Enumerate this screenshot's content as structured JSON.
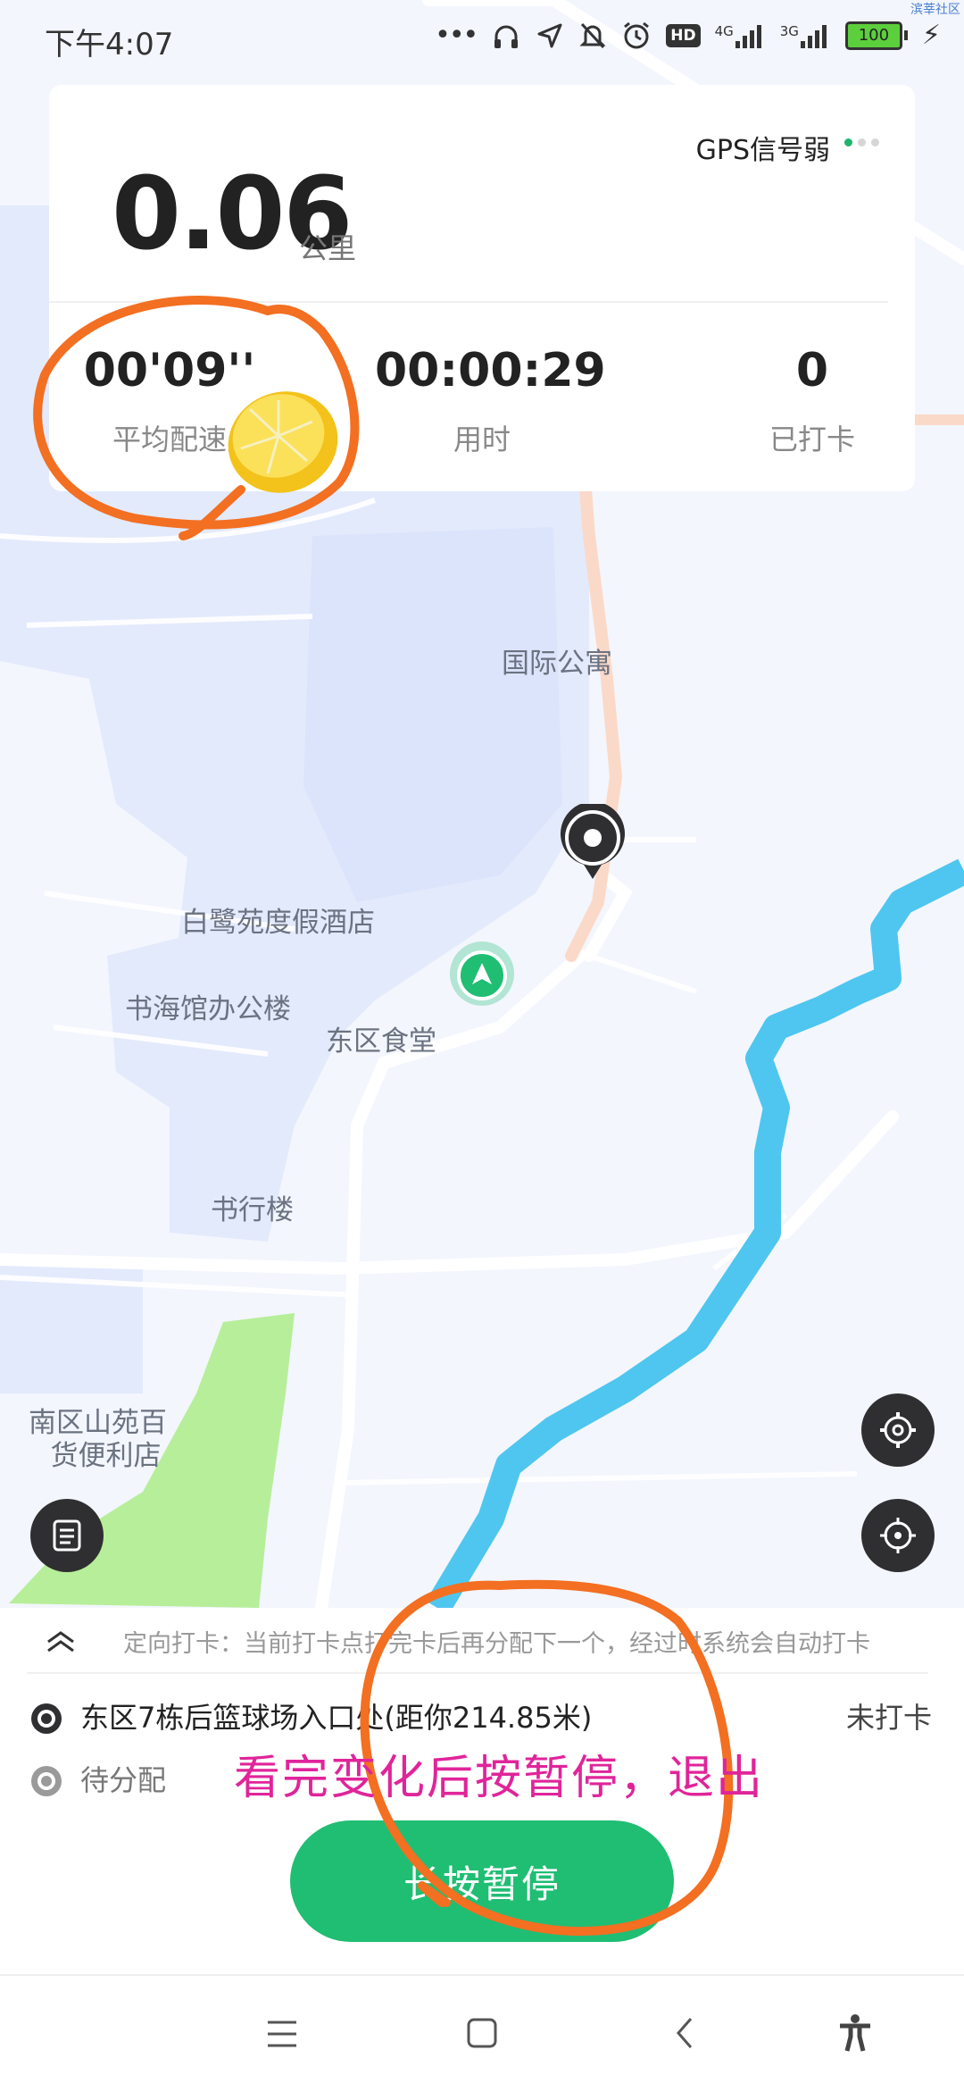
{
  "status_bar": {
    "time": "下午4:07",
    "net1": "4G",
    "net2": "3G",
    "battery": "100",
    "hd": "HD",
    "corner_text": "滨莘社区"
  },
  "stats": {
    "gps_status": "GPS信号弱",
    "distance": "0.06",
    "distance_unit": "公里",
    "pace_value": "00'09''",
    "pace_label": "平均配速",
    "duration_value": "00:00:29",
    "duration_label": "用时",
    "checked_value": "0",
    "checked_label": "已打卡"
  },
  "map": {
    "labels": {
      "international_apartment": "国际公寓",
      "egret_hotel": "白鹭苑度假酒店",
      "bookhall_office": "书海馆办公楼",
      "east_canteen": "东区食堂",
      "shuxing_building": "书行楼",
      "store_line1": "南区山苑百",
      "store_line2": "货便利店"
    }
  },
  "panel": {
    "hint": "定向打卡：当前打卡点打完卡后再分配下一个，经过时系统会自动打卡",
    "checkpoint": {
      "name": "东区7栋后篮球场入口处(距你214.85米)",
      "status": "未打卡"
    },
    "pending": "待分配",
    "pause_button": "长按暂停"
  },
  "annotation": {
    "text": "看完变化后按暂停，退出"
  },
  "colors": {
    "accent_green": "#1fbe73",
    "annotation_orange": "#f36f21",
    "annotation_magenta": "#e0249a",
    "river_blue": "#4fc6ef",
    "park_green": "#b7ee9a"
  }
}
